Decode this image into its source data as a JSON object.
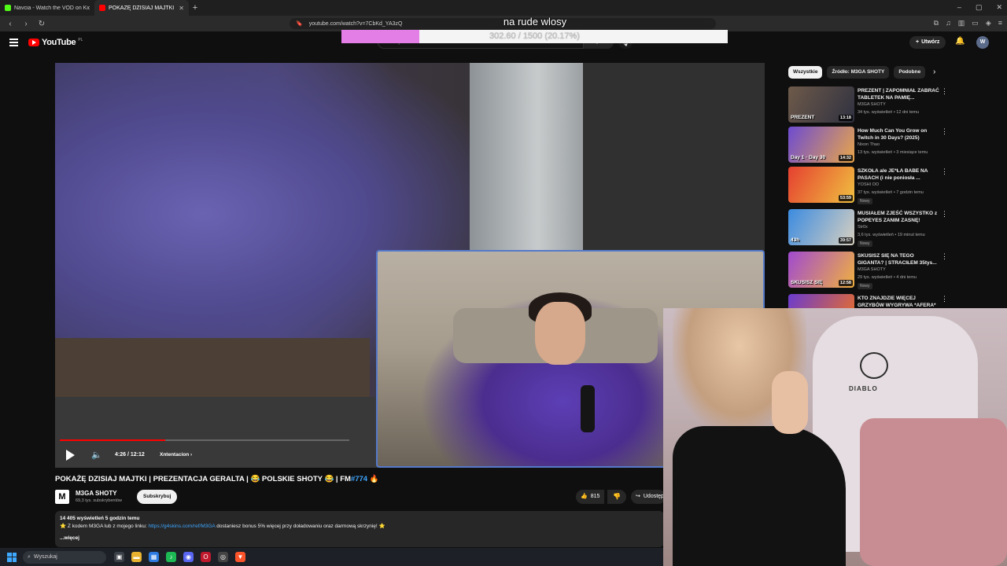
{
  "browser": {
    "tabs": [
      {
        "title": "Navcia - Watch the VOD on Kick",
        "color": "#53fc18"
      },
      {
        "title": "POKAŻĘ DZISIAJ MAJTKI | PR",
        "color": "#ff0000"
      }
    ],
    "new_tab": "+",
    "url": "youtube.com/watch?v=7CbKd_YA3zQ",
    "window_controls": [
      "–",
      "▢",
      "✕"
    ]
  },
  "overlay": {
    "title": "na rude wlosy",
    "goal_text": "302.60 / 1500 (20.17%)",
    "goal_fraction": 0.2017,
    "goal_color": "#e27ee6"
  },
  "header": {
    "logo_word": "YouTube",
    "logo_region": "PL",
    "search_placeholder": "Szukaj",
    "create_label": "Utwórz",
    "avatar_letter": "W"
  },
  "player": {
    "time": "4:26 / 12:12",
    "chapter": "Xntentacion",
    "progress_fraction": 0.364
  },
  "video": {
    "title": "POKAŻĘ DZISIAJ MAJTKI | PREZENTACJA GERALTA | 😂 POLSKIE SHOTY 😂 | FM",
    "tag": "#774",
    "tag_suffix": " 🔥",
    "channel": "M3GA SHOTY",
    "channel_initial": "M",
    "subs": "69,3 tys. subskrybentów",
    "subscribe_label": "Subskrybuj",
    "likes": "815",
    "share_label": "Udostępnij"
  },
  "description": {
    "line1": "14 405 wyświetleń  5 godzin temu",
    "line2_prefix": "⭐ Z kodem M3GA lub z mojego linku: ",
    "line2_link": "https://g4skins.com/ref/M3GA",
    "line2_suffix": " dostaniesz bonus 5% więcej przy doładowaniu oraz darmową skrzynię! ⭐",
    "more": "...więcej"
  },
  "chips": [
    "Wszystkie",
    "Źródło: M3GA SHOTY",
    "Podobne"
  ],
  "recommendations": [
    {
      "title": "PREZENT | ZAPOMNIAŁ ZABRAĆ TABLETEK NA PAMIĘ...",
      "channel": "M3GA SHOTY",
      "meta": "34 tys. wyświetleń • 12 dni temu",
      "duration": "13:18",
      "thumb_text": "PREZENT",
      "badge": "",
      "colors": [
        "#6e5a4a",
        "#2f3140"
      ]
    },
    {
      "title": "How Much Can You Grow on Twitch in 30 Days? (2025)",
      "channel": "Nixon Thao",
      "meta": "13 tys. wyświetleń • 3 miesiące temu",
      "duration": "14:32",
      "thumb_text": "Day 1 · Day 30",
      "badge": "",
      "colors": [
        "#6d4bd1",
        "#e9a64a"
      ]
    },
    {
      "title": "SZKOŁA ale JE*ŁA BABE NA PASACH (i nie poniosła ...",
      "channel": "YOSHI OO",
      "meta": "37 tys. wyświetleń • 7 godzin temu",
      "duration": "53:59",
      "thumb_text": "",
      "badge": "Nowy",
      "colors": [
        "#e54030",
        "#f0c040"
      ]
    },
    {
      "title": "MUSIAŁEM ZJEŚĆ WSZYSTKO z POPEYES ZANIM ZASNĘ!",
      "channel": "Str0x",
      "meta": "3,6 tys. wyświetleń • 19 minut temu",
      "duration": "39:57",
      "thumb_text": "43h",
      "badge": "Nowy",
      "colors": [
        "#3b8be0",
        "#d8d0c0"
      ]
    },
    {
      "title": "SKUSISZ SIĘ NA TEGO GIGANTA? | STRACIŁEM 35tys...",
      "channel": "M3GA SHOTY",
      "meta": "29 tys. wyświetleń • 4 dni temu",
      "duration": "12:58",
      "thumb_text": "SKUSISZ SIĘ",
      "badge": "Nowy",
      "colors": [
        "#a04ad0",
        "#f0b040"
      ]
    },
    {
      "title": "KTO ZNAJDZIE WIĘCEJ GRZYBÓW WYGRYWA *AFERA*",
      "channel": "",
      "meta": "",
      "duration": "",
      "thumb_text": "",
      "badge": "",
      "colors": [
        "#6a3bd0",
        "#f07020"
      ]
    }
  ],
  "facecam": {
    "brand": "DIABLO"
  },
  "taskbar": {
    "search_label": "Wyszukaj",
    "icons": [
      {
        "name": "task-view-icon",
        "glyph": "▣",
        "color": "#3c4048"
      },
      {
        "name": "file-explorer-icon",
        "glyph": "▬",
        "color": "#e8b230"
      },
      {
        "name": "store-icon",
        "glyph": "▦",
        "color": "#2d7be0"
      },
      {
        "name": "spotify-icon",
        "glyph": "♪",
        "color": "#1db954"
      },
      {
        "name": "discord-icon",
        "glyph": "◉",
        "color": "#5865f2"
      },
      {
        "name": "opera-icon",
        "glyph": "O",
        "color": "#c0182c"
      },
      {
        "name": "obs-icon",
        "glyph": "◎",
        "color": "#444"
      },
      {
        "name": "brave-icon",
        "glyph": "▼",
        "color": "#fb542b"
      }
    ]
  }
}
